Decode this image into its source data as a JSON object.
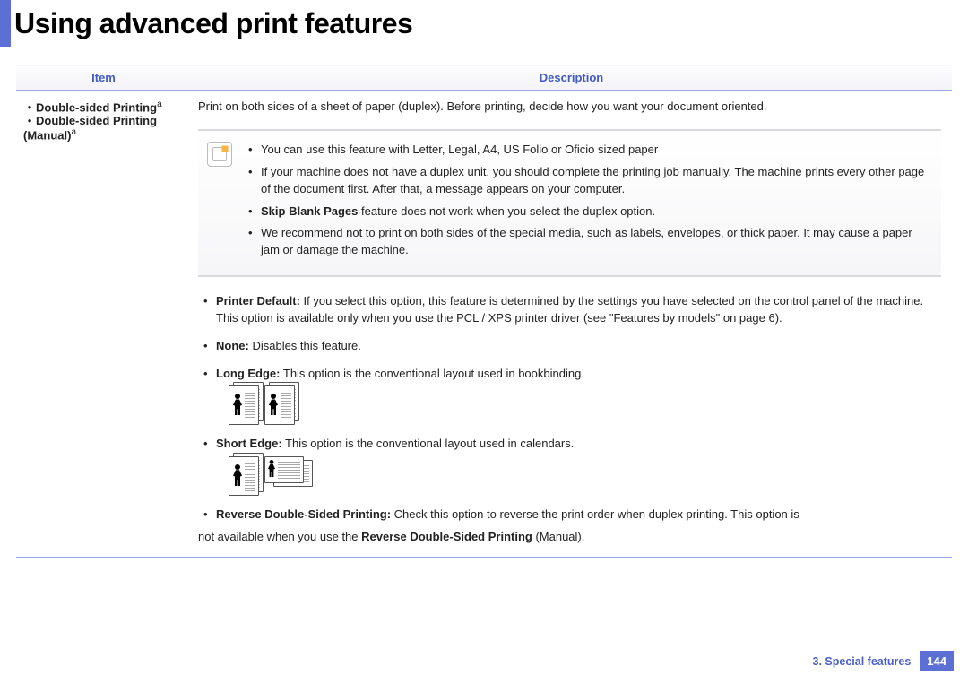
{
  "pageTitle": "Using advanced print features",
  "table": {
    "headers": {
      "item": "Item",
      "description": "Description"
    },
    "item": {
      "line1": "Double-sided Printing",
      "line1_sup": "a",
      "line2": "Double-sided Printing (Manual)",
      "line2_sup": "a"
    },
    "lead": "Print on both sides of a sheet of paper (duplex). Before printing, decide how you want your document oriented.",
    "notes": {
      "n1": "You can use this feature with Letter, Legal, A4, US Folio or Oficio sized paper",
      "n2": "If your machine does not have a duplex unit, you should complete the printing job manually. The machine prints every other page of the document first. After that, a message appears on your computer.",
      "n3_bold": "Skip Blank Pages",
      "n3_rest": " feature does not work when you select the duplex option.",
      "n4": "We recommend not to print on both sides of the special media, such as labels, envelopes, or thick paper. It may cause a paper jam or damage the machine."
    },
    "options": {
      "o1_bold": "Printer Default:",
      "o1_rest": " If you select this option, this feature is determined by the settings you have selected on the control panel of the machine. This option is available only when you use the PCL / XPS printer driver (see \"Features by models\" on page 6).",
      "o2_bold": "None:",
      "o2_rest": " Disables this feature.",
      "o3_bold": "Long Edge:",
      "o3_rest": " This option is the conventional layout used in bookbinding.",
      "o4_bold": "Short Edge:",
      "o4_rest": " This option is the conventional layout used in calendars.",
      "o5_bold": "Reverse Double-Sided Printing:",
      "o5_rest": " Check this option to reverse the print order when duplex printing. This option is"
    },
    "trailing_pre": "not available when you use the ",
    "trailing_bold": "Reverse Double-Sided Printing",
    "trailing_post": " (Manual)."
  },
  "footer": {
    "chapter": "3.  Special features",
    "page": "144"
  }
}
